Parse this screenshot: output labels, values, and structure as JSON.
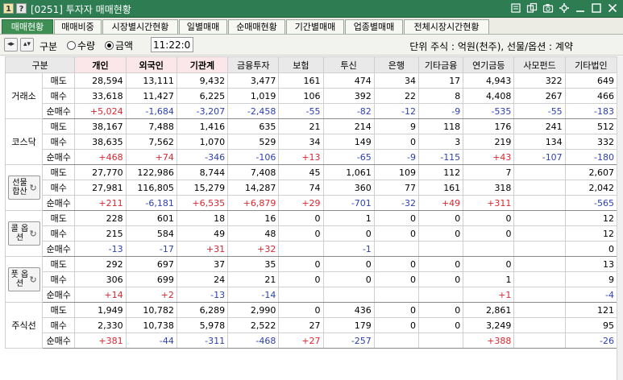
{
  "window": {
    "btn_1": "1",
    "btn_2": "?",
    "title": "[0251] 투자자 매매현황"
  },
  "tabs": [
    "매매현황",
    "매매비중",
    "시장별시간현황",
    "일별매매",
    "순매매현황",
    "기간별매매",
    "업종별매매",
    "전체시장시간현황"
  ],
  "controls": {
    "gubun_label": "구분",
    "option_qty": "수량",
    "option_amount": "금액",
    "selected": "금액",
    "time": "11:22:00",
    "unit_text": "단위 주식 : 억원(천주), 선물/옵션 : 계약"
  },
  "colors": {
    "titlebar": "#2e7d52",
    "active_tab": "#3f8f55",
    "positive": "#d9262f",
    "negative": "#2c3fb6",
    "highlight_header": "#fbe7e9"
  },
  "table": {
    "headers": [
      "구분",
      "",
      "개인",
      "외국인",
      "기관계",
      "금융투자",
      "보험",
      "투신",
      "은행",
      "기타금융",
      "연기금등",
      "사모펀드",
      "기타법인"
    ],
    "markets": [
      {
        "name": "거래소",
        "button": false,
        "rows": [
          {
            "label": "매도",
            "values": [
              "28,594",
              "13,111",
              "9,432",
              "3,477",
              "161",
              "474",
              "34",
              "17",
              "4,943",
              "322",
              "649"
            ]
          },
          {
            "label": "매수",
            "values": [
              "33,618",
              "11,427",
              "6,225",
              "1,019",
              "106",
              "392",
              "22",
              "8",
              "4,408",
              "267",
              "466"
            ]
          },
          {
            "label": "순매수",
            "values": [
              "+5,024",
              "-1,684",
              "-3,207",
              "-2,458",
              "-55",
              "-82",
              "-12",
              "-9",
              "-535",
              "-55",
              "-183"
            ]
          }
        ]
      },
      {
        "name": "코스닥",
        "button": false,
        "rows": [
          {
            "label": "매도",
            "values": [
              "38,167",
              "7,488",
              "1,416",
              "635",
              "21",
              "214",
              "9",
              "118",
              "176",
              "241",
              "512"
            ]
          },
          {
            "label": "매수",
            "values": [
              "38,635",
              "7,562",
              "1,070",
              "529",
              "34",
              "149",
              "0",
              "3",
              "219",
              "134",
              "332"
            ]
          },
          {
            "label": "순매수",
            "values": [
              "+468",
              "+74",
              "-346",
              "-106",
              "+13",
              "-65",
              "-9",
              "-115",
              "+43",
              "-107",
              "-180"
            ]
          }
        ]
      },
      {
        "name": "선물 합산",
        "button": true,
        "rows": [
          {
            "label": "매도",
            "values": [
              "27,770",
              "122,986",
              "8,744",
              "7,408",
              "45",
              "1,061",
              "109",
              "112",
              "7",
              "",
              "2,607"
            ]
          },
          {
            "label": "매수",
            "values": [
              "27,981",
              "116,805",
              "15,279",
              "14,287",
              "74",
              "360",
              "77",
              "161",
              "318",
              "",
              "2,042"
            ]
          },
          {
            "label": "순매수",
            "values": [
              "+211",
              "-6,181",
              "+6,535",
              "+6,879",
              "+29",
              "-701",
              "-32",
              "+49",
              "+311",
              "",
              "-565"
            ]
          }
        ]
      },
      {
        "name": "콜 옵션",
        "button": true,
        "rows": [
          {
            "label": "매도",
            "values": [
              "228",
              "601",
              "18",
              "16",
              "0",
              "1",
              "0",
              "0",
              "0",
              "",
              "12"
            ]
          },
          {
            "label": "매수",
            "values": [
              "215",
              "584",
              "49",
              "48",
              "0",
              "0",
              "0",
              "0",
              "0",
              "",
              "12"
            ]
          },
          {
            "label": "순매수",
            "values": [
              "-13",
              "-17",
              "+31",
              "+32",
              "",
              "-1",
              "",
              "",
              "",
              "",
              "0"
            ]
          }
        ]
      },
      {
        "name": "풋 옵션",
        "button": true,
        "rows": [
          {
            "label": "매도",
            "values": [
              "292",
              "697",
              "37",
              "35",
              "0",
              "0",
              "0",
              "0",
              "0",
              "",
              "13"
            ]
          },
          {
            "label": "매수",
            "values": [
              "306",
              "699",
              "24",
              "21",
              "0",
              "0",
              "0",
              "0",
              "1",
              "",
              "9"
            ]
          },
          {
            "label": "순매수",
            "values": [
              "+14",
              "+2",
              "-13",
              "-14",
              "",
              "",
              "",
              "",
              "+1",
              "",
              "-4"
            ]
          }
        ]
      },
      {
        "name": "주식선",
        "button": false,
        "rows": [
          {
            "label": "매도",
            "values": [
              "1,949",
              "10,782",
              "6,289",
              "2,990",
              "0",
              "436",
              "0",
              "0",
              "2,861",
              "",
              "121"
            ]
          },
          {
            "label": "매수",
            "values": [
              "2,330",
              "10,738",
              "5,978",
              "2,522",
              "27",
              "179",
              "0",
              "0",
              "3,249",
              "",
              "95"
            ]
          },
          {
            "label": "순매수",
            "values": [
              "+381",
              "-44",
              "-311",
              "-468",
              "+27",
              "-257",
              "",
              "",
              "+388",
              "",
              "-26"
            ]
          }
        ]
      }
    ]
  }
}
